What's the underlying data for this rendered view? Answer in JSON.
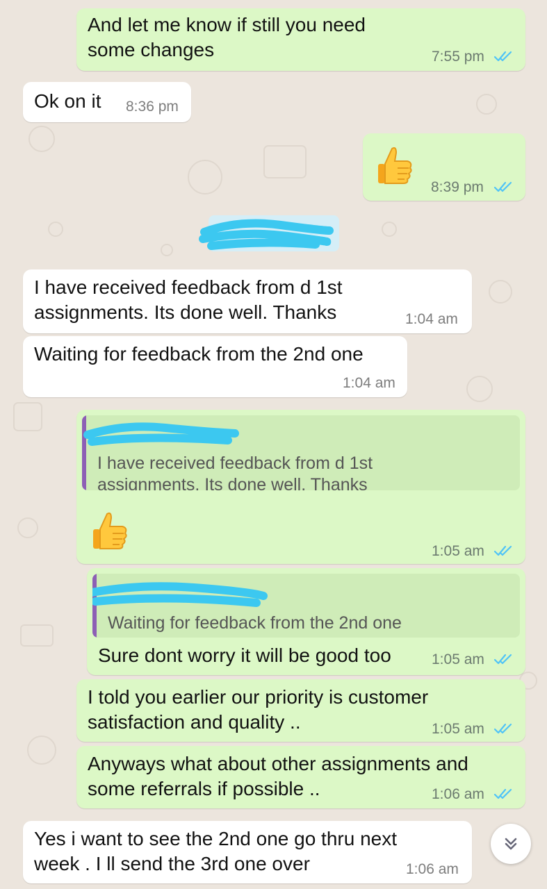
{
  "colors": {
    "outgoing_bubble": "#dcf8c6",
    "incoming_bubble": "#ffffff",
    "read_ticks": "#4fc3f7",
    "quote_bar": "#8d5fb5",
    "redaction": "#3cc8f0"
  },
  "messages": [
    {
      "direction": "out",
      "lines": [
        "And let me know if still you need",
        "some changes"
      ],
      "time": "7:55 pm",
      "status": "read"
    },
    {
      "direction": "in",
      "lines": [
        "Ok on it"
      ],
      "time": "8:36 pm"
    },
    {
      "direction": "out",
      "emoji": "thumbs-up",
      "time": "8:39 pm",
      "status": "read"
    },
    {
      "direction": "in",
      "lines": [
        "I have received feedback from d 1st",
        "assignments.  Its done well.  Thanks"
      ],
      "time": "1:04 am"
    },
    {
      "direction": "in",
      "lines": [
        "Waiting for feedback from the 2nd one"
      ],
      "time": "1:04 am"
    },
    {
      "direction": "out",
      "quote": {
        "lines": [
          "I have received feedback from d 1st",
          "assignments.  Its done well.  Thanks"
        ]
      },
      "emoji": "thumbs-up",
      "time": "1:05 am",
      "status": "read"
    },
    {
      "direction": "out",
      "quote": {
        "lines": [
          "Waiting for feedback from the 2nd one"
        ]
      },
      "lines": [
        "Sure dont worry it will be good too"
      ],
      "time": "1:05 am",
      "status": "read"
    },
    {
      "direction": "out",
      "lines": [
        "I told you earlier our priority is customer",
        "satisfaction and quality .."
      ],
      "time": "1:05 am",
      "status": "read"
    },
    {
      "direction": "out",
      "lines": [
        "Anyways what about other assignments and",
        "some referrals if possible .."
      ],
      "time": "1:06 am",
      "status": "read"
    },
    {
      "direction": "in",
      "lines": [
        "Yes i want to see the 2nd one go thru next",
        "week . I ll send the 3rd one over"
      ],
      "time": "1:06 am"
    }
  ],
  "scroll_button": {
    "icon": "double-chevron-down-icon"
  }
}
